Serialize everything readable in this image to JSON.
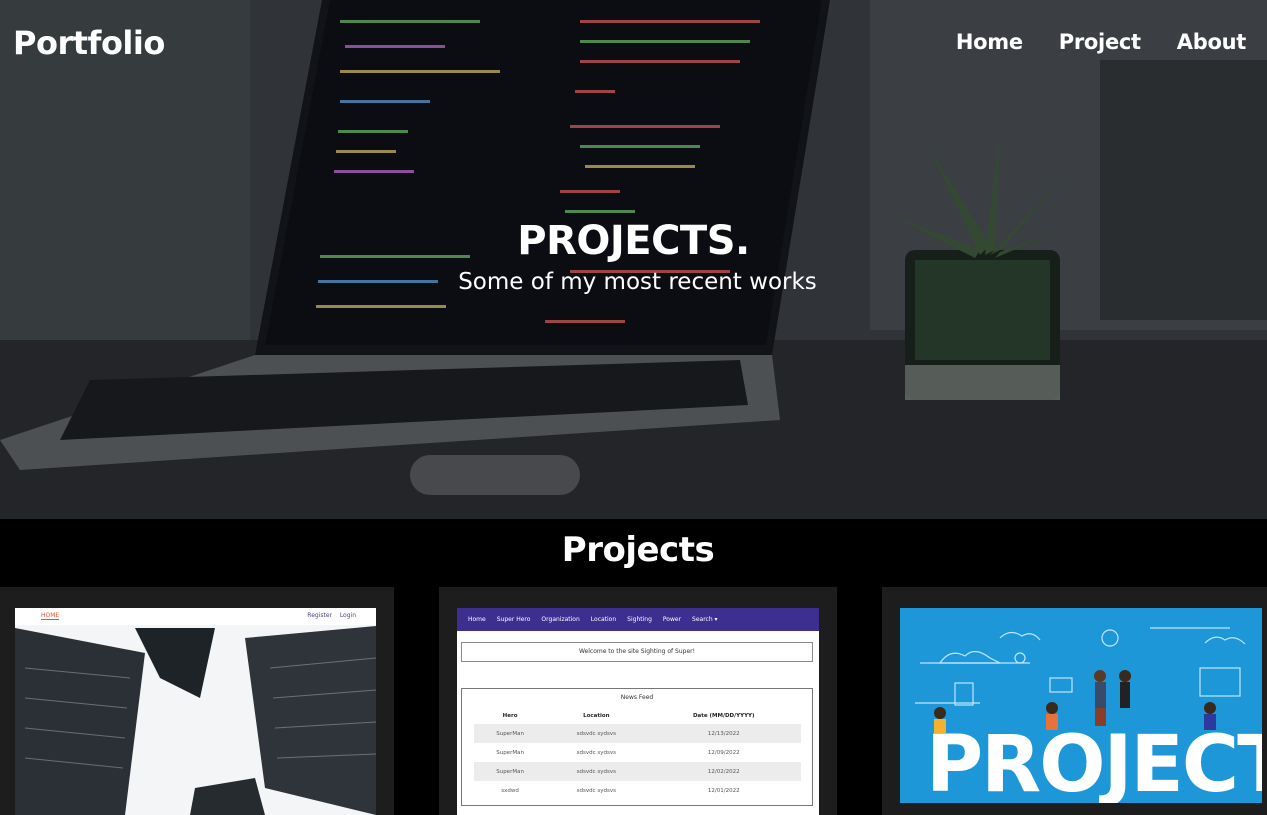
{
  "brand": "Portfolio",
  "nav": [
    "Home",
    "Project",
    "About"
  ],
  "hero": {
    "title": "PROJECTS.",
    "subtitle": "Some of my most recent works"
  },
  "section": {
    "title": "Projects"
  },
  "cards": [
    {
      "thumb_nav": {
        "home": "HOME",
        "register": "Register",
        "login": "Login"
      }
    },
    {
      "thumb_nav": [
        "Home",
        "Super Hero",
        "Organization",
        "Location",
        "Sighting",
        "Power",
        "Search ▾"
      ],
      "welcome": "Welcome to the site Sighting of Super!",
      "feed_title": "News Feed",
      "columns": [
        "Hero",
        "Location",
        "Date (MM/DD/YYYY)"
      ],
      "rows": [
        [
          "SuperMan",
          "sdsvdc sydsvs",
          "12/13/2022"
        ],
        [
          "SuperMan",
          "sdsvdc sydsvs",
          "12/09/2022"
        ],
        [
          "SuperMan",
          "sdsvdc sydsvs",
          "12/02/2022"
        ],
        [
          "sxdwd",
          "sdsvdc sydsvs",
          "12/01/2022"
        ]
      ]
    },
    {
      "word": "PROJECT"
    }
  ]
}
